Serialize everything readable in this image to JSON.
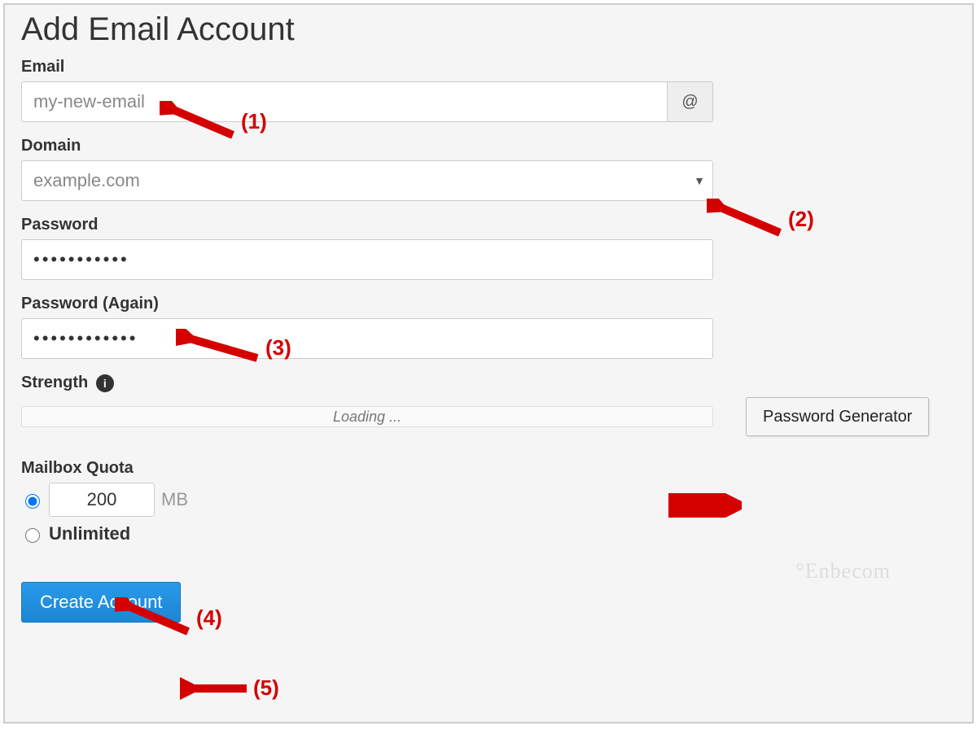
{
  "title": "Add Email Account",
  "labels": {
    "email": "Email",
    "domain": "Domain",
    "password": "Password",
    "password_again": "Password (Again)",
    "strength": "Strength",
    "mailbox_quota": "Mailbox Quota",
    "mb": "MB",
    "unlimited": "Unlimited"
  },
  "fields": {
    "email_value": "my-new-email",
    "at_symbol": "@",
    "domain_value": "example.com",
    "strength_status": "Loading ...",
    "quota_value": "200"
  },
  "buttons": {
    "password_generator": "Password Generator",
    "create_account": "Create Account"
  },
  "annotations": {
    "n1": "(1)",
    "n2": "(2)",
    "n3": "(3)",
    "n4": "(4)",
    "n5": "(5)"
  },
  "watermark": "°Enbecom"
}
